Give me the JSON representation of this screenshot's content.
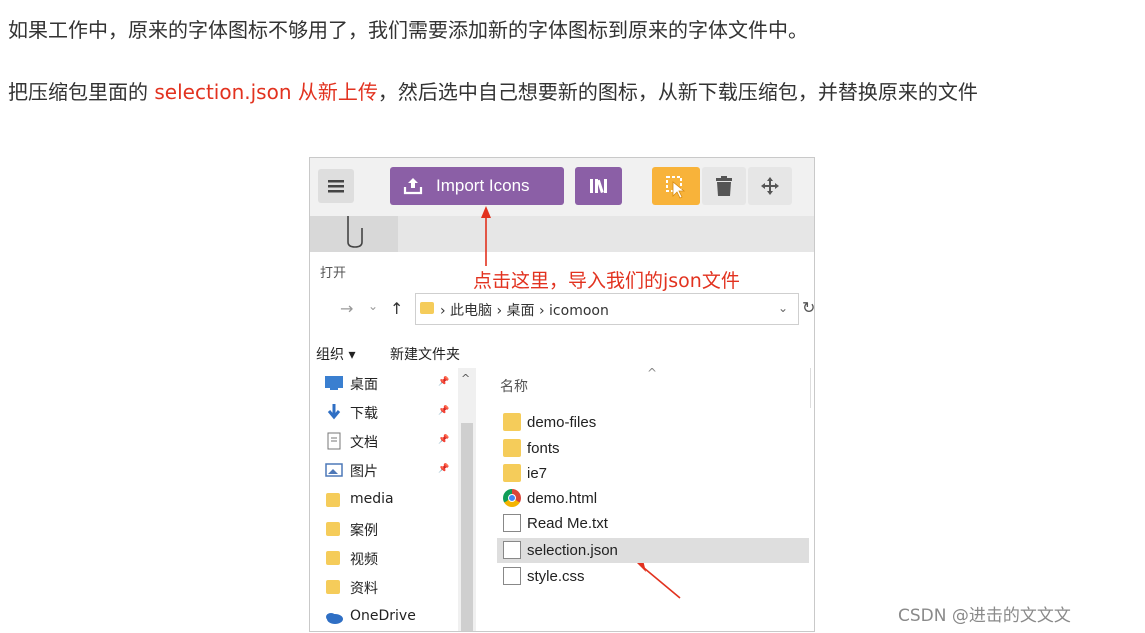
{
  "paragraphs": {
    "p1": "如果工作中，原来的字体图标不够用了，我们需要添加新的字体图标到原来的字体文件中。",
    "p2_a": "把压缩包里面的 ",
    "p2_red": "selection.json 从新上传",
    "p2_b": "，然后选中自己想要新的图标，从新下载压缩包，并替换原来的文件"
  },
  "toolbar": {
    "menu_icon": "hamburger-icon",
    "import_label": "Import Icons",
    "import_icon": "upload-icon",
    "library_icon": "library-icon",
    "select_icon": "cursor-select-icon",
    "delete_icon": "trash-icon",
    "move_icon": "move-icon",
    "accent_purple": "#8b5fa6",
    "accent_orange": "#f8b33a"
  },
  "dialog": {
    "title": "打开",
    "annotation": "点击这里，导入我们的json文件",
    "nav_back": "→",
    "nav_drop": "⌄",
    "nav_up": "↑",
    "breadcrumb": "›  此电脑  ›  桌面  ›  icomoon",
    "address_dropdown": "⌄",
    "refresh_glyph": "↻",
    "organize": "组织 ▾",
    "new_folder": "新建文件夹",
    "column_name": "名称",
    "annotation_color": "#e2321f"
  },
  "sidebar": {
    "items": [
      {
        "label": "桌面",
        "icon": "desktop-icon",
        "pinned": true
      },
      {
        "label": "下载",
        "icon": "download-icon",
        "pinned": true
      },
      {
        "label": "文档",
        "icon": "document-icon",
        "pinned": true
      },
      {
        "label": "图片",
        "icon": "pictures-icon",
        "pinned": true
      },
      {
        "label": "media",
        "icon": "folder-icon",
        "pinned": false
      },
      {
        "label": "案例",
        "icon": "folder-icon",
        "pinned": false
      },
      {
        "label": "视频",
        "icon": "folder-icon",
        "pinned": false
      },
      {
        "label": "资料",
        "icon": "folder-icon",
        "pinned": false
      },
      {
        "label": "OneDrive",
        "icon": "onedrive-icon",
        "pinned": false
      }
    ]
  },
  "files": [
    {
      "name": "demo-files",
      "icon": "folder-icon",
      "selected": false
    },
    {
      "name": "fonts",
      "icon": "folder-icon",
      "selected": false
    },
    {
      "name": "ie7",
      "icon": "folder-icon",
      "selected": false
    },
    {
      "name": "demo.html",
      "icon": "chrome-icon",
      "selected": false
    },
    {
      "name": "Read Me.txt",
      "icon": "text-file-icon",
      "selected": false
    },
    {
      "name": "selection.json",
      "icon": "json-file-icon",
      "selected": true
    },
    {
      "name": "style.css",
      "icon": "css-file-icon",
      "selected": false
    }
  ],
  "watermark": "CSDN @进击的文文文"
}
